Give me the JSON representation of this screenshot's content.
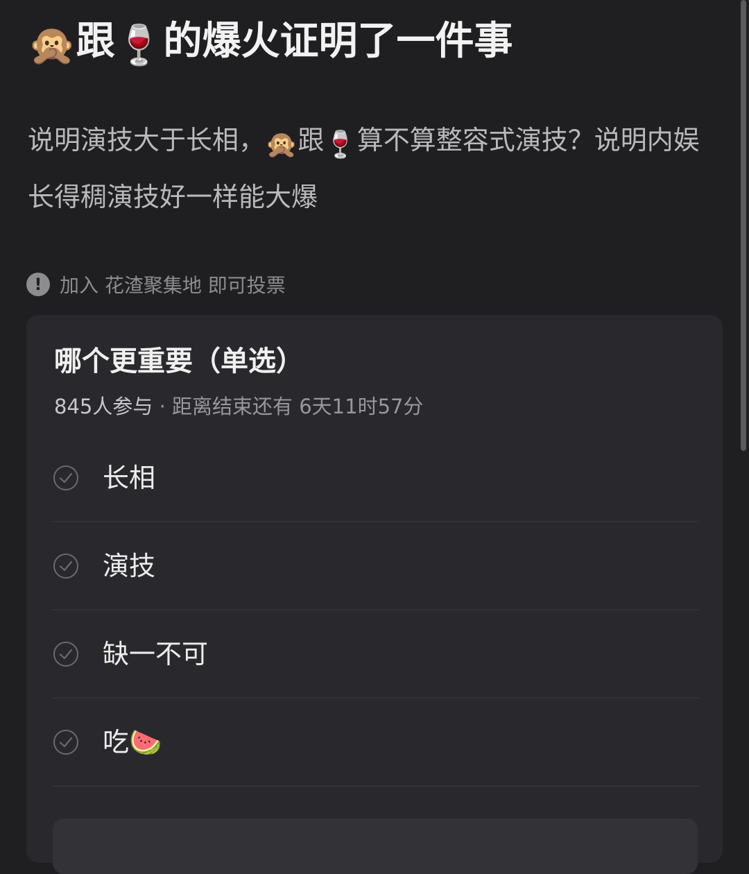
{
  "post": {
    "title_prefix_emoji": "🙊",
    "title_word1": "跟",
    "title_mid_emoji": "🍷",
    "title_rest": "的爆火证明了一件事",
    "body_part1": "说明演技大于长相，",
    "body_emoji1": "🙊",
    "body_part2": "跟",
    "body_emoji2": "🍷",
    "body_part3": "算不算整容式演技？说明内娱长得稠演技好一样能大爆"
  },
  "notice": {
    "icon": "exclamation-circle-icon",
    "text": "加入 花渣聚集地 即可投票"
  },
  "poll": {
    "title": "哪个更重要（单选）",
    "participants": "845人参与",
    "separator": " · ",
    "time_left": "距离结束还有 6天11时57分",
    "options": [
      {
        "label": "长相",
        "icon": "check-circle-icon"
      },
      {
        "label": "演技",
        "icon": "check-circle-icon"
      },
      {
        "label": "缺一不可",
        "icon": "check-circle-icon"
      },
      {
        "label": "吃🍉",
        "icon": "check-circle-icon"
      }
    ]
  }
}
